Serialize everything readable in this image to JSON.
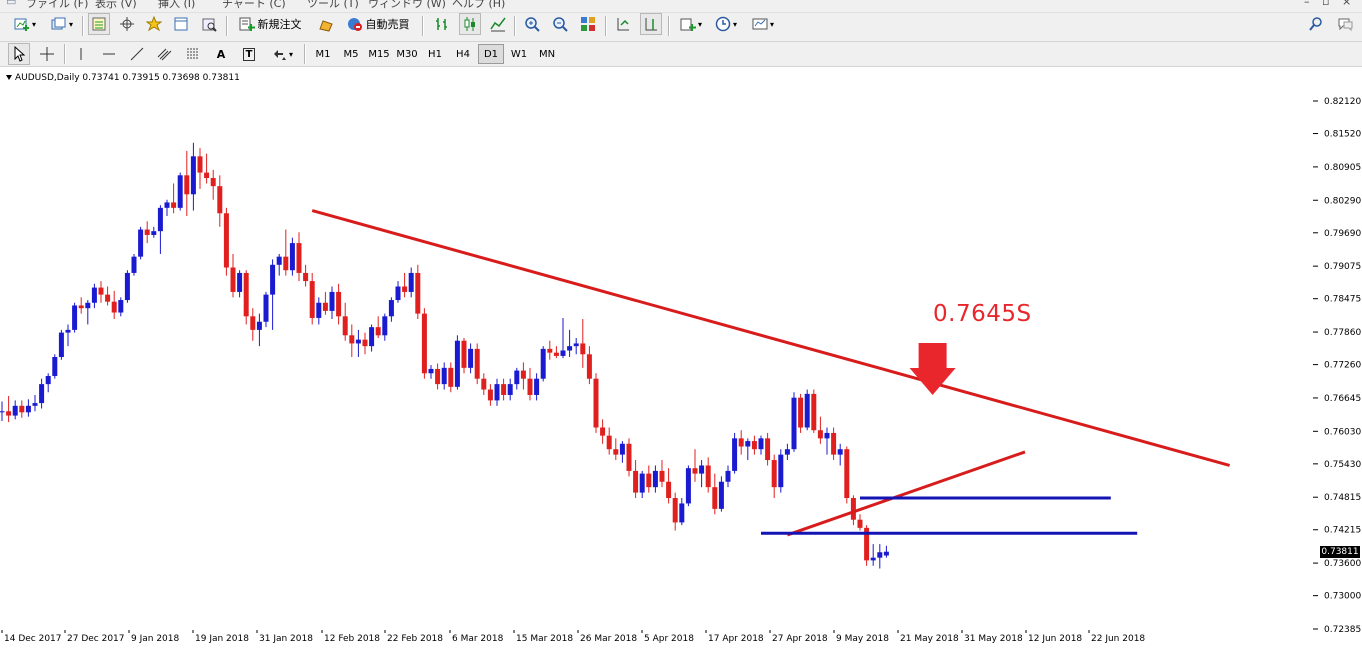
{
  "menu": {
    "items": [
      "ファイル (F)",
      "表示 (V)",
      "挿入 (I)",
      "チャート (C)",
      "ツール (T)",
      "ウィンドウ (W)",
      "ヘルプ (H)"
    ]
  },
  "toolbar": {
    "new_order_label": "新規注文",
    "autotrade_label": "自動売買",
    "icons": [
      "new-chart-icon",
      "profiles-icon",
      "market-watch-icon",
      "navigator-icon",
      "favorites-icon",
      "data-window-icon",
      "strategy-tester-icon",
      "metaeditor-icon",
      "bar-chart-icon",
      "candlestick-icon",
      "line-chart-icon",
      "zoom-in-icon",
      "zoom-out-icon",
      "tile-icon",
      "autoscroll-icon",
      "chart-shift-icon",
      "indicators-icon",
      "periods-icon",
      "templates-icon",
      "search-icon",
      "chat-icon"
    ]
  },
  "drawing_toolbar": {
    "tools": [
      "cursor-icon",
      "crosshair-icon",
      "vertical-line-icon",
      "horizontal-line-icon",
      "trendline-icon",
      "equidistant-channel-icon",
      "fibonacci-icon",
      "text-icon",
      "text-label-icon",
      "arrows-icon"
    ],
    "text_tool_label": "A",
    "label_tool_label": "T",
    "timeframes": [
      "M1",
      "M5",
      "M15",
      "M30",
      "H1",
      "H4",
      "D1",
      "W1",
      "MN"
    ],
    "active_timeframe": "D1"
  },
  "chart": {
    "symbol_info": "AUDUSD,Daily  0.73741 0.73915 0.73698 0.73811",
    "annotation": "0.7645S",
    "current_price": "0.73811",
    "colors": {
      "bull": "#1a1ad0",
      "bear": "#e0201e",
      "trendline": "#d81c1c",
      "hline": "#1414b4",
      "arrow": "#e8262c"
    }
  },
  "chart_data": {
    "type": "candlestick",
    "symbol": "AUDUSD",
    "timeframe": "Daily",
    "ohlc_latest": {
      "open": 0.73741,
      "high": 0.73915,
      "low": 0.73698,
      "close": 0.73811
    },
    "y_ticks": [
      "0.82120",
      "0.81520",
      "0.80905",
      "0.80290",
      "0.79690",
      "0.79075",
      "0.78475",
      "0.77860",
      "0.77260",
      "0.76645",
      "0.76030",
      "0.75430",
      "0.74815",
      "0.74215",
      "0.73600",
      "0.73000",
      "0.72385"
    ],
    "x_ticks": [
      "14 Dec 2017",
      "27 Dec 2017",
      "9 Jan 2018",
      "19 Jan 2018",
      "31 Jan 2018",
      "12 Feb 2018",
      "22 Feb 2018",
      "6 Mar 2018",
      "15 Mar 2018",
      "26 Mar 2018",
      "5 Apr 2018",
      "17 Apr 2018",
      "27 Apr 2018",
      "9 May 2018",
      "21 May 2018",
      "31 May 2018",
      "12 Jun 2018",
      "22 Jun 2018"
    ],
    "ylim": [
      0.7235,
      0.8235
    ],
    "candles": [
      [
        0.7638,
        0.7658,
        0.7622,
        0.764
      ],
      [
        0.764,
        0.7668,
        0.762,
        0.7632
      ],
      [
        0.7632,
        0.766,
        0.7625,
        0.765
      ],
      [
        0.765,
        0.766,
        0.7628,
        0.7638
      ],
      [
        0.7638,
        0.7662,
        0.763,
        0.765
      ],
      [
        0.765,
        0.767,
        0.764,
        0.7655
      ],
      [
        0.7655,
        0.77,
        0.7645,
        0.769
      ],
      [
        0.769,
        0.771,
        0.7675,
        0.7705
      ],
      [
        0.7705,
        0.7745,
        0.77,
        0.774
      ],
      [
        0.774,
        0.779,
        0.7735,
        0.7785
      ],
      [
        0.7785,
        0.78,
        0.776,
        0.779
      ],
      [
        0.779,
        0.784,
        0.7785,
        0.7835
      ],
      [
        0.7835,
        0.785,
        0.782,
        0.783
      ],
      [
        0.783,
        0.7845,
        0.78,
        0.784
      ],
      [
        0.784,
        0.7875,
        0.783,
        0.7868
      ],
      [
        0.7868,
        0.788,
        0.784,
        0.7855
      ],
      [
        0.7855,
        0.787,
        0.7835,
        0.7842
      ],
      [
        0.7842,
        0.7862,
        0.781,
        0.7822
      ],
      [
        0.7822,
        0.785,
        0.7815,
        0.7845
      ],
      [
        0.7845,
        0.79,
        0.784,
        0.7895
      ],
      [
        0.7895,
        0.793,
        0.789,
        0.7925
      ],
      [
        0.7925,
        0.798,
        0.792,
        0.7975
      ],
      [
        0.7975,
        0.799,
        0.795,
        0.7965
      ],
      [
        0.7965,
        0.798,
        0.796,
        0.7972
      ],
      [
        0.7972,
        0.802,
        0.793,
        0.8015
      ],
      [
        0.8015,
        0.803,
        0.8,
        0.8025
      ],
      [
        0.8025,
        0.806,
        0.8005,
        0.8015
      ],
      [
        0.8015,
        0.808,
        0.801,
        0.8075
      ],
      [
        0.8075,
        0.812,
        0.8,
        0.804
      ],
      [
        0.804,
        0.8135,
        0.801,
        0.811
      ],
      [
        0.811,
        0.8125,
        0.805,
        0.808
      ],
      [
        0.808,
        0.8115,
        0.806,
        0.807
      ],
      [
        0.807,
        0.8085,
        0.803,
        0.8055
      ],
      [
        0.8055,
        0.8075,
        0.798,
        0.8005
      ],
      [
        0.8005,
        0.8015,
        0.789,
        0.7905
      ],
      [
        0.7905,
        0.793,
        0.785,
        0.786
      ],
      [
        0.786,
        0.79,
        0.785,
        0.7895
      ],
      [
        0.7895,
        0.79,
        0.78,
        0.7815
      ],
      [
        0.7815,
        0.783,
        0.777,
        0.779
      ],
      [
        0.779,
        0.782,
        0.776,
        0.7805
      ],
      [
        0.7805,
        0.786,
        0.7795,
        0.7855
      ],
      [
        0.7855,
        0.792,
        0.779,
        0.791
      ],
      [
        0.791,
        0.793,
        0.789,
        0.7925
      ],
      [
        0.7925,
        0.7975,
        0.789,
        0.79
      ],
      [
        0.79,
        0.796,
        0.789,
        0.795
      ],
      [
        0.795,
        0.797,
        0.788,
        0.7895
      ],
      [
        0.7895,
        0.791,
        0.787,
        0.788
      ],
      [
        0.788,
        0.7895,
        0.78,
        0.7812
      ],
      [
        0.7812,
        0.785,
        0.78,
        0.784
      ],
      [
        0.784,
        0.786,
        0.7818,
        0.7825
      ],
      [
        0.7825,
        0.787,
        0.781,
        0.786
      ],
      [
        0.786,
        0.7875,
        0.78,
        0.7815
      ],
      [
        0.7815,
        0.784,
        0.777,
        0.778
      ],
      [
        0.778,
        0.78,
        0.774,
        0.7765
      ],
      [
        0.7765,
        0.779,
        0.774,
        0.7772
      ],
      [
        0.7772,
        0.7785,
        0.7745,
        0.776
      ],
      [
        0.776,
        0.78,
        0.775,
        0.7795
      ],
      [
        0.7795,
        0.7815,
        0.7775,
        0.778
      ],
      [
        0.778,
        0.782,
        0.777,
        0.7815
      ],
      [
        0.7815,
        0.785,
        0.7805,
        0.7845
      ],
      [
        0.7845,
        0.788,
        0.784,
        0.787
      ],
      [
        0.787,
        0.7895,
        0.785,
        0.786
      ],
      [
        0.786,
        0.7905,
        0.785,
        0.7895
      ],
      [
        0.7895,
        0.791,
        0.781,
        0.782
      ],
      [
        0.782,
        0.783,
        0.77,
        0.771
      ],
      [
        0.771,
        0.7725,
        0.77,
        0.7718
      ],
      [
        0.7718,
        0.7728,
        0.768,
        0.769
      ],
      [
        0.769,
        0.773,
        0.768,
        0.772
      ],
      [
        0.772,
        0.773,
        0.7675,
        0.7685
      ],
      [
        0.7685,
        0.778,
        0.768,
        0.777
      ],
      [
        0.777,
        0.7775,
        0.771,
        0.772
      ],
      [
        0.772,
        0.7765,
        0.771,
        0.7755
      ],
      [
        0.7755,
        0.7765,
        0.769,
        0.77
      ],
      [
        0.77,
        0.771,
        0.767,
        0.768
      ],
      [
        0.768,
        0.769,
        0.765,
        0.766
      ],
      [
        0.766,
        0.77,
        0.765,
        0.769
      ],
      [
        0.769,
        0.77,
        0.766,
        0.767
      ],
      [
        0.767,
        0.77,
        0.766,
        0.769
      ],
      [
        0.769,
        0.772,
        0.768,
        0.7715
      ],
      [
        0.7715,
        0.773,
        0.768,
        0.77
      ],
      [
        0.77,
        0.772,
        0.766,
        0.767
      ],
      [
        0.767,
        0.771,
        0.766,
        0.77
      ],
      [
        0.77,
        0.776,
        0.7695,
        0.7755
      ],
      [
        0.7755,
        0.777,
        0.7735,
        0.7748
      ],
      [
        0.7748,
        0.776,
        0.7738,
        0.7742
      ],
      [
        0.7742,
        0.7812,
        0.7738,
        0.7752
      ],
      [
        0.7752,
        0.779,
        0.774,
        0.776
      ],
      [
        0.776,
        0.7775,
        0.7745,
        0.7765
      ],
      [
        0.7765,
        0.781,
        0.772,
        0.7745
      ],
      [
        0.7745,
        0.776,
        0.769,
        0.77
      ],
      [
        0.77,
        0.771,
        0.76,
        0.761
      ],
      [
        0.761,
        0.7625,
        0.758,
        0.7595
      ],
      [
        0.7595,
        0.761,
        0.756,
        0.757
      ],
      [
        0.757,
        0.759,
        0.755,
        0.756
      ],
      [
        0.756,
        0.7585,
        0.7545,
        0.758
      ],
      [
        0.758,
        0.759,
        0.752,
        0.753
      ],
      [
        0.753,
        0.755,
        0.748,
        0.749
      ],
      [
        0.749,
        0.753,
        0.748,
        0.7525
      ],
      [
        0.7525,
        0.754,
        0.749,
        0.75
      ],
      [
        0.75,
        0.754,
        0.749,
        0.753
      ],
      [
        0.753,
        0.755,
        0.75,
        0.751
      ],
      [
        0.751,
        0.7535,
        0.747,
        0.748
      ],
      [
        0.748,
        0.749,
        0.742,
        0.7435
      ],
      [
        0.7435,
        0.748,
        0.743,
        0.747
      ],
      [
        0.747,
        0.754,
        0.7465,
        0.7535
      ],
      [
        0.7535,
        0.757,
        0.751,
        0.7525
      ],
      [
        0.7525,
        0.755,
        0.75,
        0.754
      ],
      [
        0.754,
        0.7555,
        0.749,
        0.75
      ],
      [
        0.75,
        0.7525,
        0.745,
        0.746
      ],
      [
        0.746,
        0.752,
        0.7455,
        0.751
      ],
      [
        0.751,
        0.754,
        0.75,
        0.753
      ],
      [
        0.753,
        0.76,
        0.7525,
        0.759
      ],
      [
        0.759,
        0.7605,
        0.756,
        0.7575
      ],
      [
        0.7575,
        0.759,
        0.755,
        0.7585
      ],
      [
        0.7585,
        0.7595,
        0.756,
        0.757
      ],
      [
        0.757,
        0.7595,
        0.756,
        0.759
      ],
      [
        0.759,
        0.76,
        0.754,
        0.755
      ],
      [
        0.755,
        0.756,
        0.748,
        0.75
      ],
      [
        0.75,
        0.757,
        0.749,
        0.756
      ],
      [
        0.756,
        0.758,
        0.755,
        0.757
      ],
      [
        0.757,
        0.7675,
        0.7565,
        0.7665
      ],
      [
        0.7665,
        0.7672,
        0.76,
        0.761
      ],
      [
        0.761,
        0.768,
        0.7605,
        0.7672
      ],
      [
        0.7672,
        0.768,
        0.76,
        0.7605
      ],
      [
        0.7605,
        0.763,
        0.758,
        0.759
      ],
      [
        0.759,
        0.761,
        0.756,
        0.76
      ],
      [
        0.76,
        0.761,
        0.755,
        0.756
      ],
      [
        0.756,
        0.758,
        0.754,
        0.757
      ],
      [
        0.757,
        0.7575,
        0.747,
        0.748
      ],
      [
        0.748,
        0.7485,
        0.743,
        0.744
      ],
      [
        0.744,
        0.745,
        0.742,
        0.7425
      ],
      [
        0.7425,
        0.743,
        0.7355,
        0.7365
      ],
      [
        0.7365,
        0.7395,
        0.7355,
        0.737
      ],
      [
        0.737,
        0.7395,
        0.735,
        0.738
      ],
      [
        0.7374,
        0.7392,
        0.737,
        0.7381
      ]
    ],
    "lines": [
      {
        "type": "trendline",
        "from": {
          "candle": 47,
          "price": 0.801
        },
        "to": {
          "candle": 186,
          "price": 0.754
        }
      },
      {
        "type": "trendline",
        "from": {
          "candle": 119,
          "price": 0.7412
        },
        "to": {
          "candle": 155,
          "price": 0.7565
        }
      },
      {
        "type": "horizontal",
        "price": 0.748,
        "from_candle": 130,
        "to_candle": 168
      },
      {
        "type": "horizontal",
        "price": 0.7415,
        "from_candle": 115,
        "to_candle": 172
      }
    ],
    "arrow": {
      "candle": 141,
      "price": 0.767,
      "direction": "down"
    }
  }
}
